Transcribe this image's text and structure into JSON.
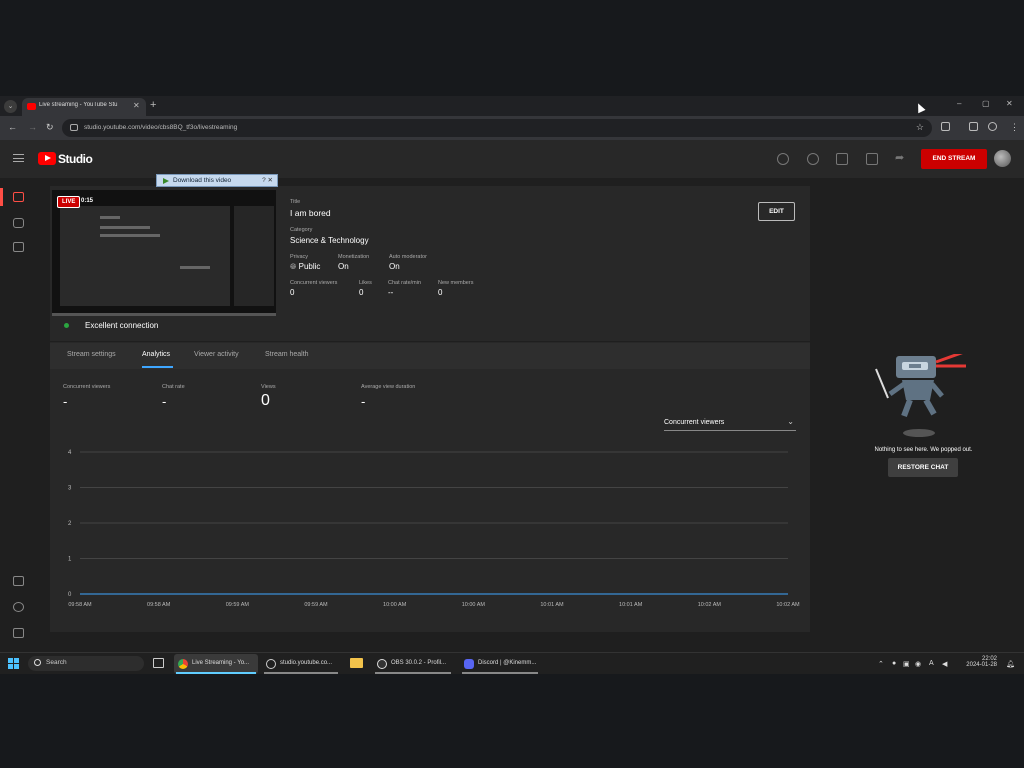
{
  "browser": {
    "tab_title": "Live streaming - YouTube Stu",
    "url": "studio.youtube.com/video/cbs8BQ_tf3o/livestreaming",
    "window_controls": [
      "–",
      "▢",
      "✕"
    ]
  },
  "header": {
    "logo_text": "Studio",
    "end_stream_label": "END STREAM"
  },
  "download_bar": {
    "label": "Download this video",
    "buttons": "? ✕"
  },
  "stream": {
    "live_badge": "LIVE",
    "elapsed": "0:15",
    "title_label": "Title",
    "title": "I am bored",
    "category_label": "Category",
    "category": "Science & Technology",
    "privacy_label": "Privacy",
    "privacy": "Public",
    "monetization_label": "Monetization",
    "monetization": "On",
    "auto_moderator_label": "Auto moderator",
    "auto_moderator": "On",
    "concurrent_viewers_label": "Concurrent viewers",
    "concurrent_viewers": "0",
    "likes_label": "Likes",
    "likes": "0",
    "chat_rate_label": "Chat rate/min",
    "chat_rate": "--",
    "new_members_label": "New members",
    "new_members": "0",
    "edit_label": "EDIT",
    "connection": "Excellent connection",
    "connection_color": "#2ba640"
  },
  "tabs": [
    {
      "label": "Stream settings"
    },
    {
      "label": "Analytics"
    },
    {
      "label": "Viewer activity"
    },
    {
      "label": "Stream health"
    }
  ],
  "metrics": [
    {
      "label": "Concurrent viewers",
      "value": "-"
    },
    {
      "label": "Chat rate",
      "value": "-"
    },
    {
      "label": "Views",
      "value": "0"
    },
    {
      "label": "Average view duration",
      "value": "-"
    }
  ],
  "metric_select": "Concurrent viewers",
  "chart_data": {
    "type": "line",
    "x": [
      "09:58 AM",
      "09:58 AM",
      "09:59 AM",
      "09:59 AM",
      "10:00 AM",
      "10:00 AM",
      "10:01 AM",
      "10:01 AM",
      "10:02 AM",
      "10:02 AM"
    ],
    "series": [
      {
        "values": [
          0,
          0,
          0,
          0,
          0,
          0,
          0,
          0,
          0,
          0
        ]
      }
    ],
    "y_ticks": [
      "0",
      "1",
      "2",
      "3",
      "4"
    ],
    "ylim": [
      0,
      4
    ],
    "grid": true
  },
  "chat": {
    "message": "Nothing to see here. We popped out.",
    "restore_label": "RESTORE CHAT"
  },
  "taskbar": {
    "search_placeholder": "Search",
    "apps": [
      {
        "label": "Live Streaming - Yo..."
      },
      {
        "label": "studio.youtube.co..."
      },
      {
        "label": "OBS 30.0.2 - Profil..."
      },
      {
        "label": "Discord | @Kinemm..."
      }
    ],
    "time": "22:02",
    "date": "2024-01-28",
    "tray_letter": "A"
  }
}
